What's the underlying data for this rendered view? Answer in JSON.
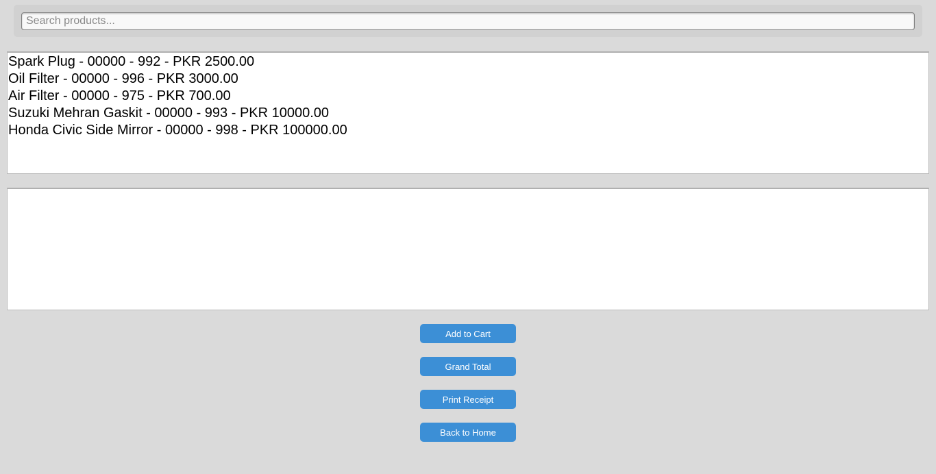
{
  "search": {
    "placeholder": "Search products...",
    "value": ""
  },
  "products": [
    {
      "label": "Spark Plug - 00000 - 992 - PKR 2500.00"
    },
    {
      "label": "Oil Filter - 00000 - 996 - PKR 3000.00"
    },
    {
      "label": "Air Filter - 00000 - 975 - PKR 700.00"
    },
    {
      "label": "Suzuki Mehran Gaskit - 00000 - 993 - PKR 10000.00"
    },
    {
      "label": "Honda Civic Side Mirror - 00000 - 998 - PKR 100000.00"
    }
  ],
  "cart": [],
  "buttons": {
    "add_to_cart": "Add to Cart",
    "grand_total": "Grand Total",
    "print_receipt": "Print Receipt",
    "back_to_home": "Back to Home"
  },
  "colors": {
    "background": "#dadada",
    "button": "#3c8fd6",
    "button_text": "#ffffff"
  }
}
